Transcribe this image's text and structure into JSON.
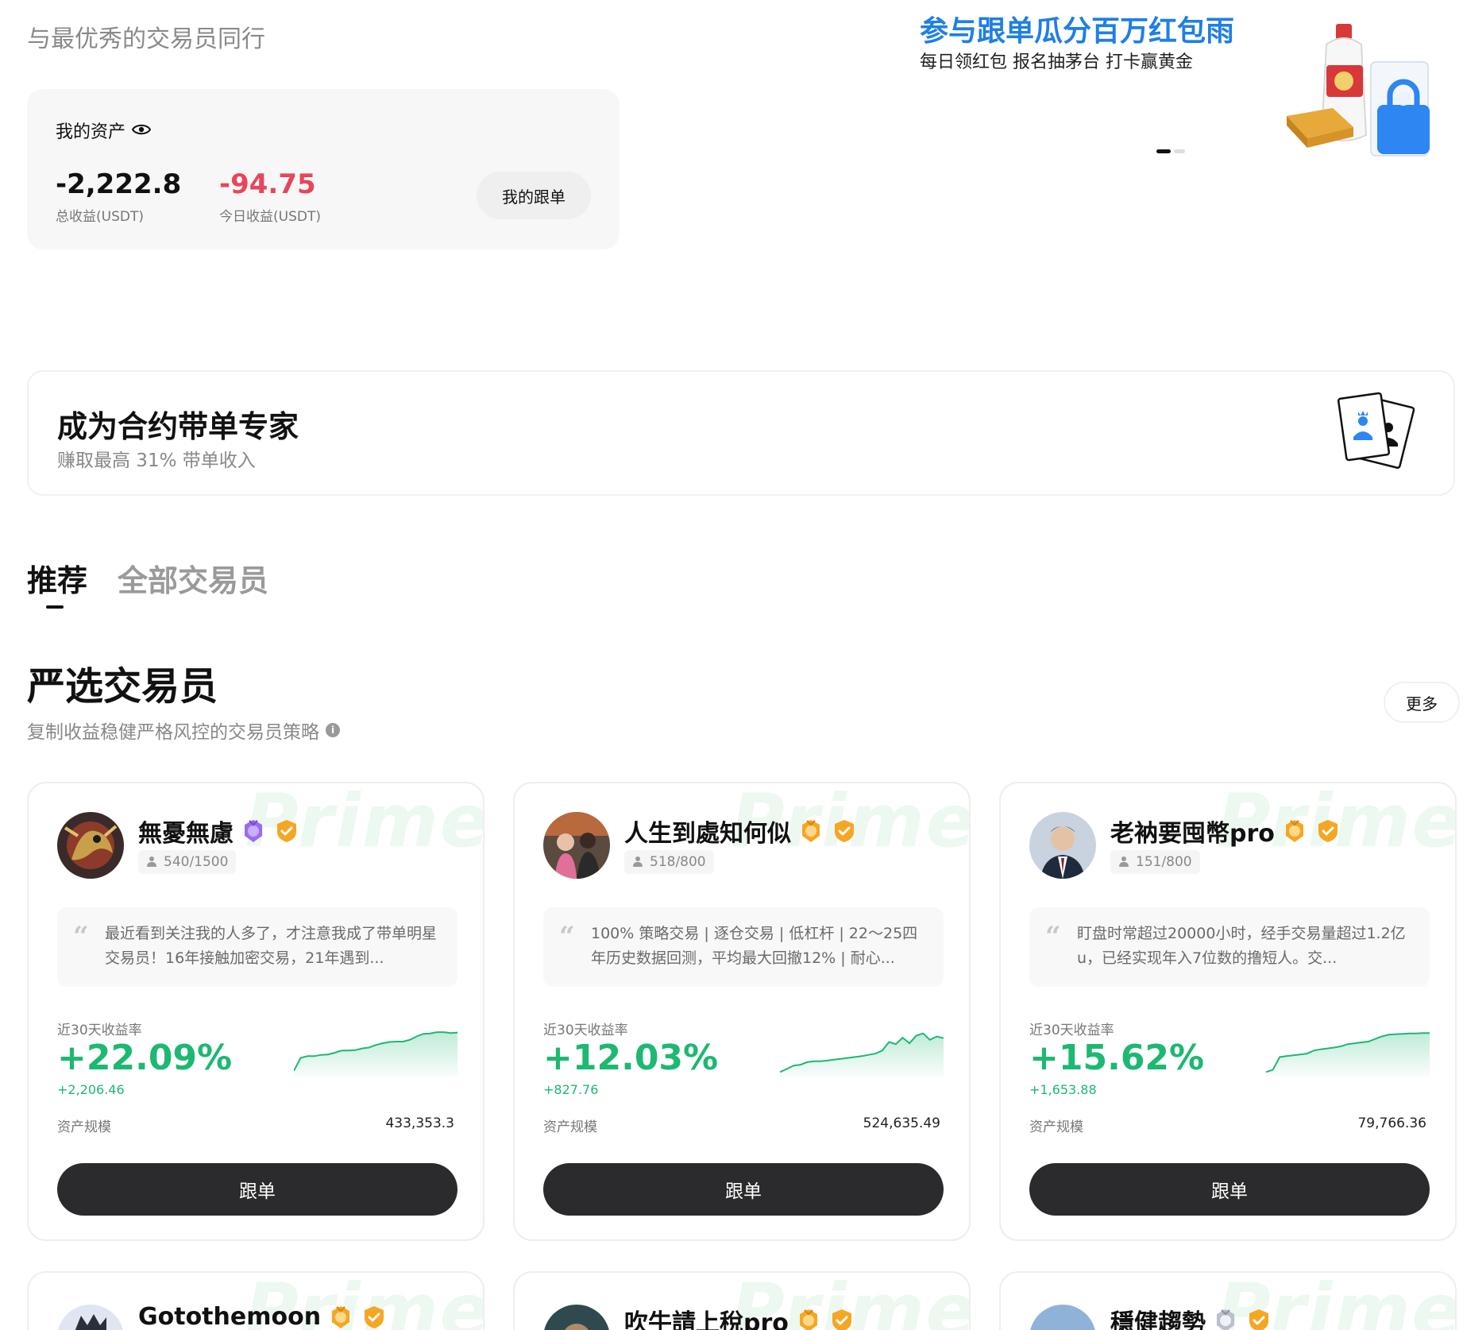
{
  "header": {
    "tagline": "与最优秀的交易员同行"
  },
  "assets": {
    "title": "我的资产",
    "total_value": "-2,222.8",
    "total_label": "总收益(USDT)",
    "today_value": "-94.75",
    "today_label": "今日收益(USDT)",
    "my_follow_label": "我的跟单",
    "colors": {
      "today_value": "#e8455a"
    }
  },
  "banner": {
    "title": "参与跟单瓜分百万红包雨",
    "subtitle": "每日领红包 报名抽茅台 打卡赢黄金"
  },
  "expert": {
    "title": "成为合约带单专家",
    "subtitle": "赚取最高 31% 带单收入"
  },
  "tabs": [
    {
      "label": "推荐",
      "active": true
    },
    {
      "label": "全部交易员",
      "active": false
    }
  ],
  "section": {
    "title": "严选交易员",
    "subtitle": "复制收益稳健严格风控的交易员策略",
    "more_label": "更多"
  },
  "traders": [
    {
      "name": "無憂無慮",
      "followers": "540/1500",
      "quote": "最近看到关注我的人多了，才注意我成了带单明星交易员！16年接触加密交易，21年遇到...",
      "roi_label": "近30天收益率",
      "roi": "+22.09%",
      "pnl": "+2,206.46",
      "aum_label": "资产规模",
      "aum": "433,353.3",
      "follow_label": "跟单",
      "watermark": "Prime",
      "badge_icon": "purple-medal-icon"
    },
    {
      "name": "人生到處知何似",
      "followers": "518/800",
      "quote": "100% 策略交易 | 逐仓交易 | 低杠杆 | 22～25四年历史数据回测，平均最大回撤12% | 耐心...",
      "roi_label": "近30天收益率",
      "roi": "+12.03%",
      "pnl": "+827.76",
      "aum_label": "资产规模",
      "aum": "524,635.49",
      "follow_label": "跟单",
      "watermark": "Prime",
      "badge_icon": "gold-medal-icon"
    },
    {
      "name": "老衲要囤幣pro",
      "followers": "151/800",
      "quote": "盯盘时常超过20000小时，经手交易量超过1.2亿u，已经实现年入7位数的撸短人。交...",
      "roi_label": "近30天收益率",
      "roi": "+15.62%",
      "pnl": "+1,653.88",
      "aum_label": "资产规模",
      "aum": "79,766.36",
      "follow_label": "跟单",
      "watermark": "Prime",
      "badge_icon": "gold-medal-icon"
    },
    {
      "name": "Gotothemoon",
      "watermark": "Prime",
      "badge_icon": "gold-medal-icon"
    },
    {
      "name": "吹牛請上稅pro",
      "watermark": "Prime",
      "badge_icon": "gold-medal-icon"
    },
    {
      "name": "穩健趨勢",
      "watermark": "Prime",
      "badge_icon": "silver-medal-icon"
    }
  ],
  "sparklines": [
    [
      0.08,
      0.38,
      0.42,
      0.42,
      0.45,
      0.46,
      0.5,
      0.55,
      0.55,
      0.56,
      0.6,
      0.62,
      0.68,
      0.72,
      0.75,
      0.76,
      0.76,
      0.8,
      0.88,
      0.94,
      0.95,
      0.98,
      0.98,
      0.96,
      0.97
    ],
    [
      0.05,
      0.12,
      0.2,
      0.22,
      0.28,
      0.3,
      0.3,
      0.32,
      0.34,
      0.36,
      0.38,
      0.4,
      0.42,
      0.45,
      0.48,
      0.55,
      0.75,
      0.7,
      0.85,
      0.72,
      0.9,
      0.95,
      0.8,
      0.88,
      0.84
    ],
    [
      0.05,
      0.1,
      0.4,
      0.42,
      0.44,
      0.46,
      0.48,
      0.55,
      0.58,
      0.6,
      0.62,
      0.65,
      0.7,
      0.72,
      0.74,
      0.76,
      0.82,
      0.88,
      0.92,
      0.93,
      0.94,
      0.95,
      0.95,
      0.96,
      0.96
    ]
  ],
  "colors": {
    "accent_green": "#1db872",
    "button_dark": "#2b2b2d",
    "banner_blue": "#1f7fe6",
    "loss_red": "#e8455a"
  }
}
